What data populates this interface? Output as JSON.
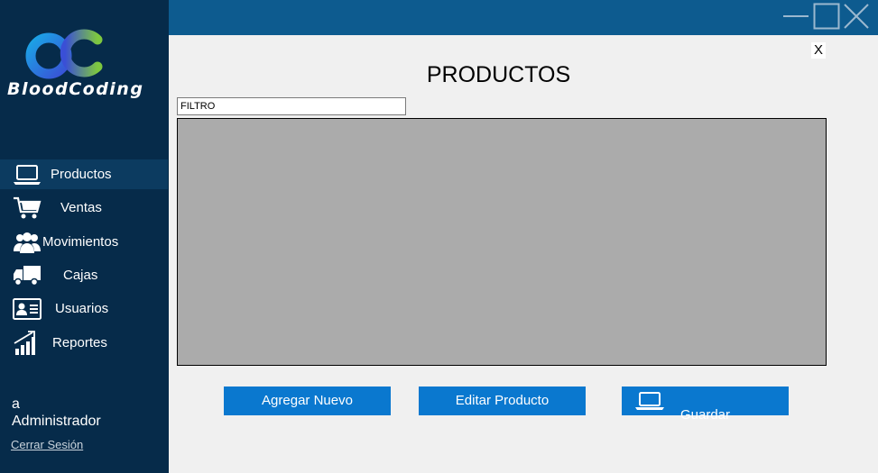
{
  "brand": {
    "logo_text": "BloodCoding"
  },
  "sidebar": {
    "items": [
      {
        "label": "Productos",
        "icon": "laptop-icon",
        "active": true
      },
      {
        "label": "Ventas",
        "icon": "cart-icon",
        "active": false
      },
      {
        "label": "Movimientos",
        "icon": "users-icon",
        "active": false
      },
      {
        "label": "Cajas",
        "icon": "truck-icon",
        "active": false
      },
      {
        "label": "Usuarios",
        "icon": "id-card-icon",
        "active": false
      },
      {
        "label": "Reportes",
        "icon": "bar-chart-icon",
        "active": false
      }
    ],
    "user": {
      "name": "a",
      "role": "Administrador",
      "logout_label": "Cerrar Sesión"
    }
  },
  "window": {
    "close_label": "X"
  },
  "main": {
    "title": "PRODUCTOS",
    "filter": {
      "value": "FILTRO"
    },
    "buttons": {
      "add_label": "Agregar Nuevo",
      "edit_label": "Editar Producto",
      "save_label": "Guardar"
    }
  },
  "colors": {
    "sidebar_bg": "#062b4a",
    "titlebar_bg": "#0d5b8f",
    "accent_button": "#0a78cf",
    "grid_bg": "#ababab"
  }
}
